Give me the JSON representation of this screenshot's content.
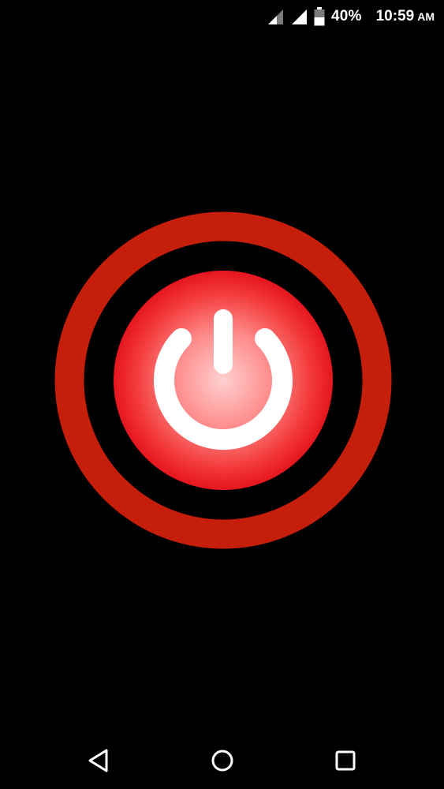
{
  "status_bar": {
    "battery_percent": "40%",
    "time": "10:59",
    "am_pm": "AM",
    "icons": [
      "signal-sim1-icon",
      "signal-sim2-icon",
      "battery-icon"
    ]
  },
  "power_button": {
    "icon": "power-icon",
    "colors": {
      "ring": "#c51e0b",
      "button_center": "#ffc7c7",
      "button_edge": "#e5151e",
      "symbol": "#ffffff"
    }
  },
  "nav_bar": {
    "icons": [
      "back-icon",
      "home-icon",
      "recents-icon"
    ]
  }
}
